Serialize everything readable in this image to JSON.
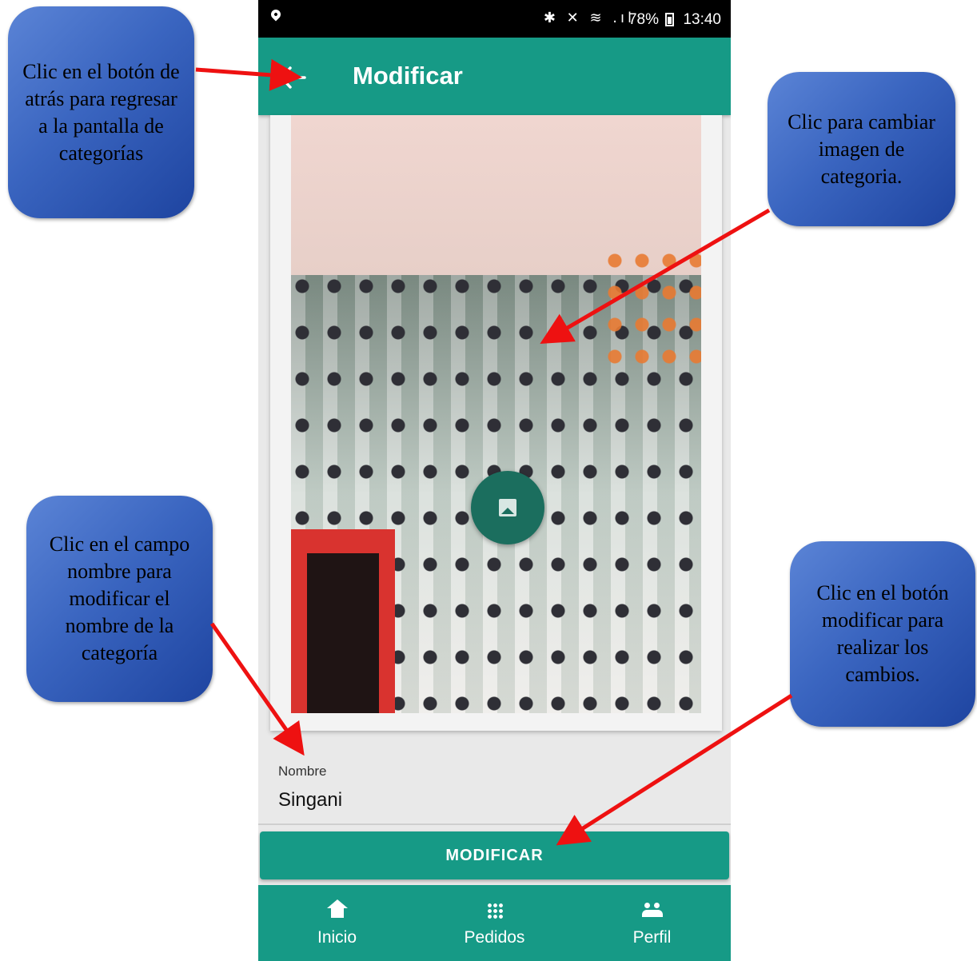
{
  "status_bar": {
    "time": "13:40",
    "battery": "78%",
    "icons": "✱ ✕ ≋ .ıl"
  },
  "app_bar": {
    "title": "Modificar",
    "back_icon": "back-arrow-icon"
  },
  "image_card": {
    "change_image_icon": "image-icon"
  },
  "form": {
    "name_label": "Nombre",
    "name_value": "Singani"
  },
  "primary_button": {
    "label": "MODIFICAR"
  },
  "bottom_nav": [
    {
      "label": "Inicio",
      "icon": "home-icon"
    },
    {
      "label": "Pedidos",
      "icon": "grid-icon"
    },
    {
      "label": "Perfil",
      "icon": "people-icon"
    }
  ],
  "callouts": {
    "back": "Clic en el botón de atrás para regresar a la pantalla de categorías",
    "image": "Clic para cambiar imagen de categoria.",
    "name": "Clic en el campo nombre para modificar el nombre de la categoría",
    "button": "Clic en el botón modificar para realizar los cambios."
  },
  "colors": {
    "accent": "#169a86",
    "fab": "#1b6e5e",
    "callout": "#3a65c0",
    "arrow": "#ee1111"
  }
}
